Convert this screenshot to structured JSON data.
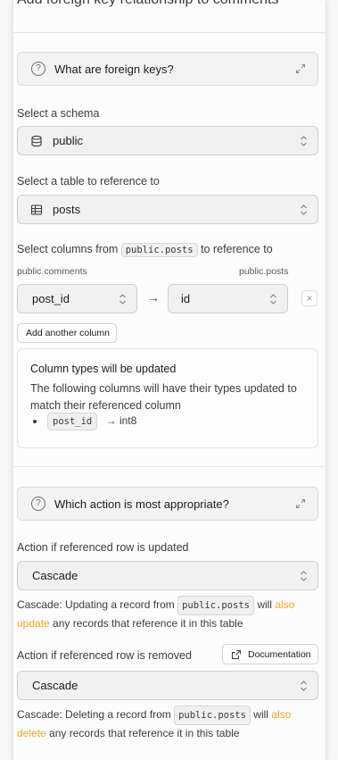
{
  "panel": {
    "title": "Add foreign key relationship to comments"
  },
  "help_foreign_keys": {
    "label": "What are foreign keys?",
    "question_glyph": "?"
  },
  "schema": {
    "label": "Select a schema",
    "value": "public"
  },
  "table": {
    "label": "Select a table to reference to",
    "value": "posts"
  },
  "columns": {
    "label_prefix": "Select columns from",
    "label_code": "public.posts",
    "label_suffix": "to reference to",
    "source_table": "public.comments",
    "target_table": "public.posts",
    "rows": [
      {
        "source": "post_id",
        "target": "id"
      }
    ],
    "arrow": "→",
    "remove_glyph": "×",
    "add_button": "Add another column"
  },
  "type_notice": {
    "title": "Column types will be updated",
    "body": "The following columns will have their types updated to match their referenced column",
    "items": [
      {
        "column": "post_id",
        "arrow": "→",
        "type": "int8"
      }
    ]
  },
  "help_actions": {
    "label": "Which action is most appropriate?",
    "question_glyph": "?"
  },
  "on_update": {
    "label": "Action if referenced row is updated",
    "value": "Cascade",
    "desc_prefix": "Cascade: Updating a record from",
    "desc_code": "public.posts",
    "desc_will": "will",
    "desc_accent": "also update",
    "desc_suffix": "any records that reference it in this table"
  },
  "on_delete": {
    "label": "Action if referenced row is removed",
    "doc_button": "Documentation",
    "value": "Cascade",
    "desc_prefix": "Cascade: Deleting a record from",
    "desc_code": "public.posts",
    "desc_will": "will",
    "desc_accent": "also delete",
    "desc_suffix": "any records that reference it in this table"
  },
  "colors": {
    "accent": "#f5a623",
    "panel_bg": "#fcfcfc",
    "select_bg": "#f1f1f1",
    "text": "#1c1c1c"
  },
  "icons": {
    "help": "question-circle-icon",
    "expand": "expand-diagonal-icon",
    "schema": "database-icon",
    "table": "table-grid-icon",
    "chevron": "chevron-up-down-icon",
    "remove": "close-icon",
    "external": "external-link-icon"
  }
}
